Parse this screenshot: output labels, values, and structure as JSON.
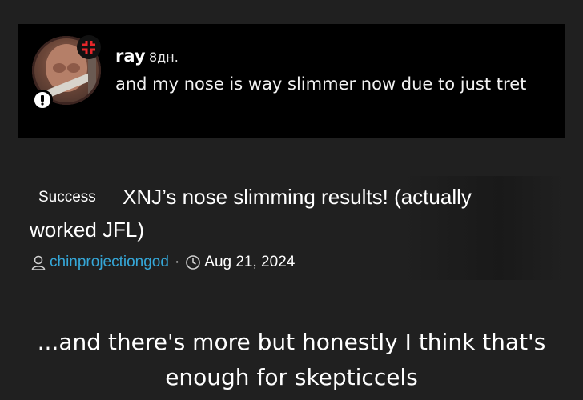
{
  "comment": {
    "author": "ray",
    "time": "8дн.",
    "text": "and my nose is way slimmer now due to just tret"
  },
  "thread": {
    "prefix": "Success",
    "title": "XNJ’s nose slimming results! (actually worked JFL)",
    "author": "chinprojectiongod",
    "separator": "·",
    "date": "Aug 21, 2024"
  },
  "caption": "...and there's more but honestly I think that's enough for skepticcels",
  "colors": {
    "background": "#202020",
    "comment_card": "#000000",
    "author_link": "#35a7d8"
  }
}
